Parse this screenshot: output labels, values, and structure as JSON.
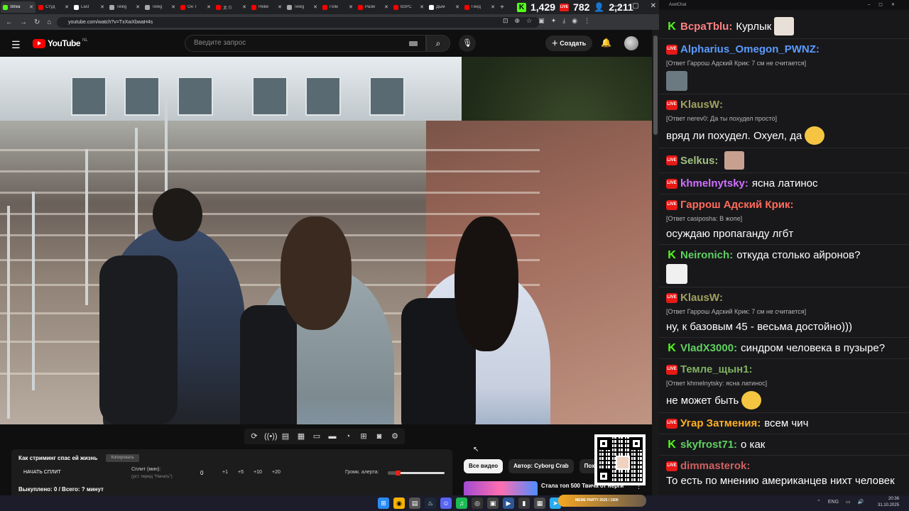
{
  "browser": {
    "tabs": [
      {
        "label": "Strea",
        "color": "#53fc18",
        "active": true
      },
      {
        "label": "Студ",
        "color": "#ff0000",
        "active": false
      },
      {
        "label": "Last",
        "color": "#ffffff",
        "active": false
      },
      {
        "label": "Teleg",
        "color": "#aaaaaa",
        "active": false
      },
      {
        "label": "Teleg",
        "color": "#aaaaaa",
        "active": false
      },
      {
        "label": "Он Т",
        "color": "#ff0000",
        "active": false
      },
      {
        "label": "太 П",
        "color": "#ff0000",
        "active": false
      },
      {
        "label": "Неве",
        "color": "#ff0000",
        "active": false
      },
      {
        "label": "Teleg",
        "color": "#aaaaaa",
        "active": false
      },
      {
        "label": "Пом",
        "color": "#ff0000",
        "active": false
      },
      {
        "label": "Разм",
        "color": "#ff0000",
        "active": false
      },
      {
        "label": "ВЗРС",
        "color": "#ff0000",
        "active": false
      },
      {
        "label": "Дым",
        "color": "#ffffff",
        "active": false
      },
      {
        "label": "Генд",
        "color": "#ff0000",
        "active": false
      }
    ],
    "url": "youtube.com/watch?v=TxXwXbwaH4s"
  },
  "overlay": {
    "kick_count": "1,429",
    "live_count": "782",
    "viewers": "2,211",
    "kick_glyph": "K",
    "live_label": "LIVE"
  },
  "youtube": {
    "logo_text": "YouTube",
    "country": "NL",
    "search_placeholder": "Введите запрос",
    "create_label": "Создать"
  },
  "panel": {
    "title": "Как стриминг спас ей жизнь",
    "copy_label": "Копировать",
    "start_label": "НАЧАТЬ СПЛИТ",
    "split_label": "Сплит (мин):",
    "split_note": "(уст. перед \"Начать\")",
    "split_value": "0",
    "buttons": [
      "+1",
      "+5",
      "+10",
      "+20"
    ],
    "volume_label": "Громк. алерта:",
    "volume_level": 0.18,
    "status": "Выкуплено: 0 / Всего: ? минут"
  },
  "chips": [
    "Все видео",
    "Автор: Cyborg Crab",
    "Похо"
  ],
  "recommendation": {
    "title": "Стала топ 500 Твича от нерги"
  },
  "chat": {
    "window_title": "AxelChat",
    "messages": [
      {
        "platform": "kick",
        "user": "ВсраТblu",
        "color": "#ff8080",
        "text": "Курлык",
        "reply": "",
        "emote": "#e8e0d8",
        "emote_block": false
      },
      {
        "platform": "live",
        "user": "Alpharius_Omegon_PWNZ",
        "color": "#5b9bff",
        "text": "",
        "reply": "[Ответ Гаррош Адский Крик: 7 см не считается]",
        "emote": "#6a7a80",
        "emote_block": true
      },
      {
        "platform": "live",
        "user": "KlausW",
        "color": "#a0a060",
        "text": "",
        "reply": "[Ответ nerev0: Да ты похудел просто]",
        "emote": "",
        "emote_block": false
      },
      {
        "platform": "none",
        "user": "",
        "color": "",
        "text": "вряд ли похудел. Охуел, да",
        "reply": "",
        "emote": "#f5c542",
        "emote_block": false
      },
      {
        "platform": "live",
        "user": "Selkus",
        "color": "#a0c080",
        "text": "",
        "reply": "",
        "emote": "#c8a090",
        "emote_block": false
      },
      {
        "platform": "live",
        "user": "khmelnytsky",
        "color": "#d070ff",
        "text": "ясна латинос",
        "reply": "",
        "emote": "",
        "emote_block": false
      },
      {
        "platform": "live",
        "user": "Гаррош Адский Крик",
        "color": "#ff6b5b",
        "text": "",
        "reply": "[Ответ casiposha: В жопе]",
        "emote": "",
        "emote_block": false
      },
      {
        "platform": "none",
        "user": "",
        "color": "",
        "text": "осуждаю пропаганду лгбт",
        "reply": "",
        "emote": "",
        "emote_block": false
      },
      {
        "platform": "kick",
        "user": "Neironich",
        "color": "#60d060",
        "text": "откуда столько айронов?",
        "reply": "",
        "emote": "#f0f0f0",
        "emote_block": true
      },
      {
        "platform": "live",
        "user": "KlausW",
        "color": "#a0a060",
        "text": "",
        "reply": "[Ответ Гаррош Адский Крик: 7 см не считается]",
        "emote": "",
        "emote_block": false
      },
      {
        "platform": "none",
        "user": "",
        "color": "",
        "text": "ну, к базовым 45 - весьма достойно)))",
        "reply": "",
        "emote": "",
        "emote_block": false
      },
      {
        "platform": "kick",
        "user": "VladX3000",
        "color": "#60d060",
        "text": "синдром человека в пузыре?",
        "reply": "",
        "emote": "",
        "emote_block": false
      },
      {
        "platform": "live",
        "user": "Темле_щын1",
        "color": "#80b060",
        "text": "",
        "reply": "[Ответ khmelnytsky: ясна латинос]",
        "emote": "",
        "emote_block": false
      },
      {
        "platform": "none",
        "user": "",
        "color": "",
        "text": "не может быть",
        "reply": "",
        "emote": "#f5c542",
        "emote_block": false
      },
      {
        "platform": "live",
        "user": "Угар Затмения",
        "color": "#ffb020",
        "text": "всем чич",
        "reply": "",
        "emote": "",
        "emote_block": false
      },
      {
        "platform": "kick",
        "user": "skyfrost71",
        "color": "#60d060",
        "text": "о как",
        "reply": "",
        "emote": "",
        "emote_block": false
      },
      {
        "platform": "live",
        "user": "dimmasterok",
        "color": "#d06060",
        "text": "То есть по мнению американцев нихт человек",
        "reply": "",
        "emote": "",
        "emote_block": false
      }
    ]
  },
  "taskbar": {
    "meme_label": "MEME PARTY 2025 / 1500",
    "lang": "ENG",
    "time": "20:36",
    "date": "31.10.2025"
  }
}
